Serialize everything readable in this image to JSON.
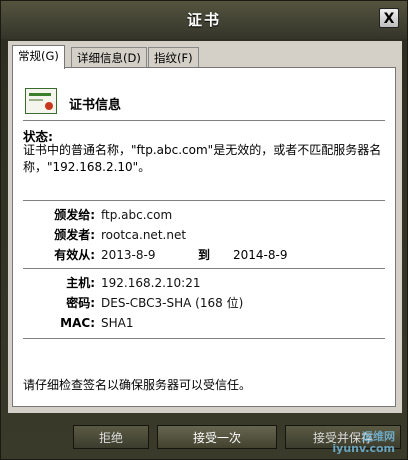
{
  "window": {
    "title": "证书",
    "close_glyph": "X"
  },
  "tabs": [
    {
      "label": "常规(G)"
    },
    {
      "label": "详细信息(D)"
    },
    {
      "label": "指纹(F)"
    }
  ],
  "general": {
    "heading": "证书信息",
    "status_label": "状态:",
    "status_text": "证书中的普通名称，\"ftp.abc.com\"是无效的，或者不匹配服务器名称，\"192.168.2.10\"。",
    "issued_to_label": "颁发给:",
    "issued_to": "ftp.abc.com",
    "issued_by_label": "颁发者:",
    "issued_by": "rootca.net.net",
    "valid_from_label": "有效从:",
    "valid_from": "2013-8-9",
    "valid_to_label": "到",
    "valid_to": "2014-8-9",
    "host_label": "主机:",
    "host": "192.168.2.10:21",
    "cipher_label": "密码:",
    "cipher": "DES-CBC3-SHA (168 位)",
    "mac_label": "MAC:",
    "mac": "SHA1",
    "note": "请仔细检查签名以确保服务器可以受信任。"
  },
  "buttons": {
    "reject": "拒绝",
    "accept_once": "接受一次",
    "accept_save": "接受并保存"
  },
  "watermark": {
    "line1": "运维网",
    "line2": "iyunv.com"
  }
}
